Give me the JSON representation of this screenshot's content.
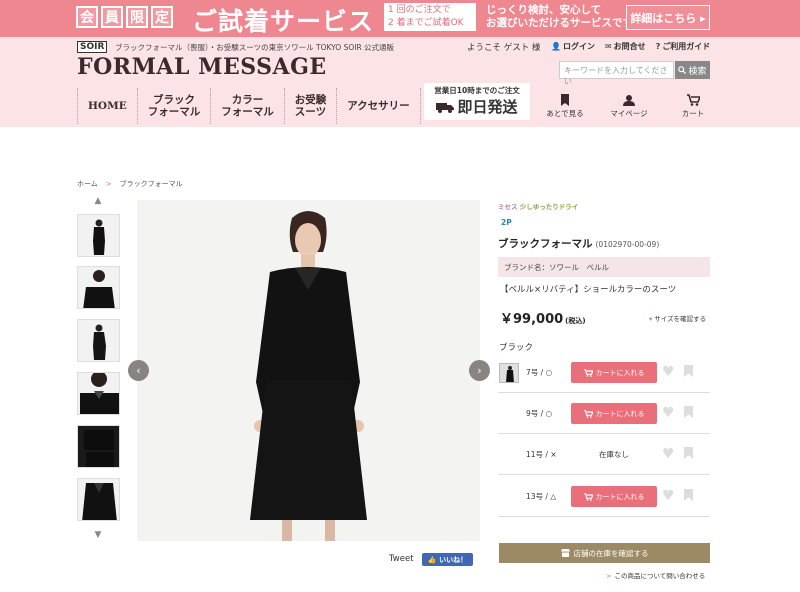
{
  "banner": {
    "chars": [
      "会",
      "員",
      "限",
      "定"
    ],
    "title": "ご試着サービス",
    "note_line1": "1 回のご注文で",
    "note_line2": "2 着までご試着OK",
    "msg_line1": "じっくり検討、安心して",
    "msg_line2": "お選びいただけるサービスです",
    "detail_button": "詳細はこちら ▸"
  },
  "header": {
    "small_logo": "SOIR",
    "subtitle": "ブラックフォーマル（喪服）・お受験スーツの東京ソワール TOKYO SOIR 公式通販",
    "welcome": "ようこそ ゲスト 様",
    "links": [
      {
        "icon": "👤",
        "label": "ログイン"
      },
      {
        "icon": "✉",
        "label": "お問合せ"
      },
      {
        "icon": "?",
        "label": "ご利用ガイド"
      }
    ],
    "site_title": "FORMAL MESSAGE",
    "search_placeholder": "キーワードを入力してください",
    "search_button": "検索",
    "nav": [
      {
        "line1": "HOME",
        "line2": ""
      },
      {
        "line1": "ブラック",
        "line2": "フォーマル"
      },
      {
        "line1": "カラー",
        "line2": "フォーマル"
      },
      {
        "line1": "お受験",
        "line2": "スーツ"
      },
      {
        "line1": "アクセサリー",
        "line2": ""
      }
    ],
    "ship_note": "営業日10時までのご注文",
    "ship_main": "即日発送",
    "icons": [
      {
        "glyph": "▮",
        "label": "あとで見る"
      },
      {
        "glyph": "●",
        "label": "マイページ"
      },
      {
        "glyph": "🛒",
        "label": "カート"
      }
    ]
  },
  "breadcrumb": {
    "items": [
      "ホーム",
      "ブラックフォーマル"
    ],
    "separator": ">"
  },
  "gallery": {
    "prev": "‹",
    "next": "›",
    "up": "▲",
    "down": "▼",
    "tweet": "Tweet",
    "like": "👍 いいね！"
  },
  "product": {
    "tag_mrs": "ミセス",
    "tag_fit": "少しゆったりドライ",
    "tag_2p": "2P",
    "name": "ブラックフォーマル",
    "code": "(0102970-00-09)",
    "brand": "ブランド名：ソワール　ベルル",
    "subtitle": "【ベルル×リバティ】ショールカラーのスーツ",
    "price": "￥99,000",
    "tax": "(税込)",
    "size_link": "サイズを確認する",
    "color": "ブラック",
    "rows": [
      {
        "size": "7号 / ○",
        "status": "cart"
      },
      {
        "size": "9号 / ○",
        "status": "cart"
      },
      {
        "size": "11号 / ×",
        "status": "none"
      },
      {
        "size": "13号 / △",
        "status": "cart"
      }
    ],
    "cart_label": "カートに入れる",
    "none_label": "在庫なし",
    "stock_button": "店舗の在庫を確認する",
    "contact_link": "この商品について問い合わせる"
  },
  "colors": {
    "banner": "#ee8790",
    "header_bg": "#fce4e6",
    "cart": "#e96f7a",
    "stock": "#9c8a65"
  }
}
